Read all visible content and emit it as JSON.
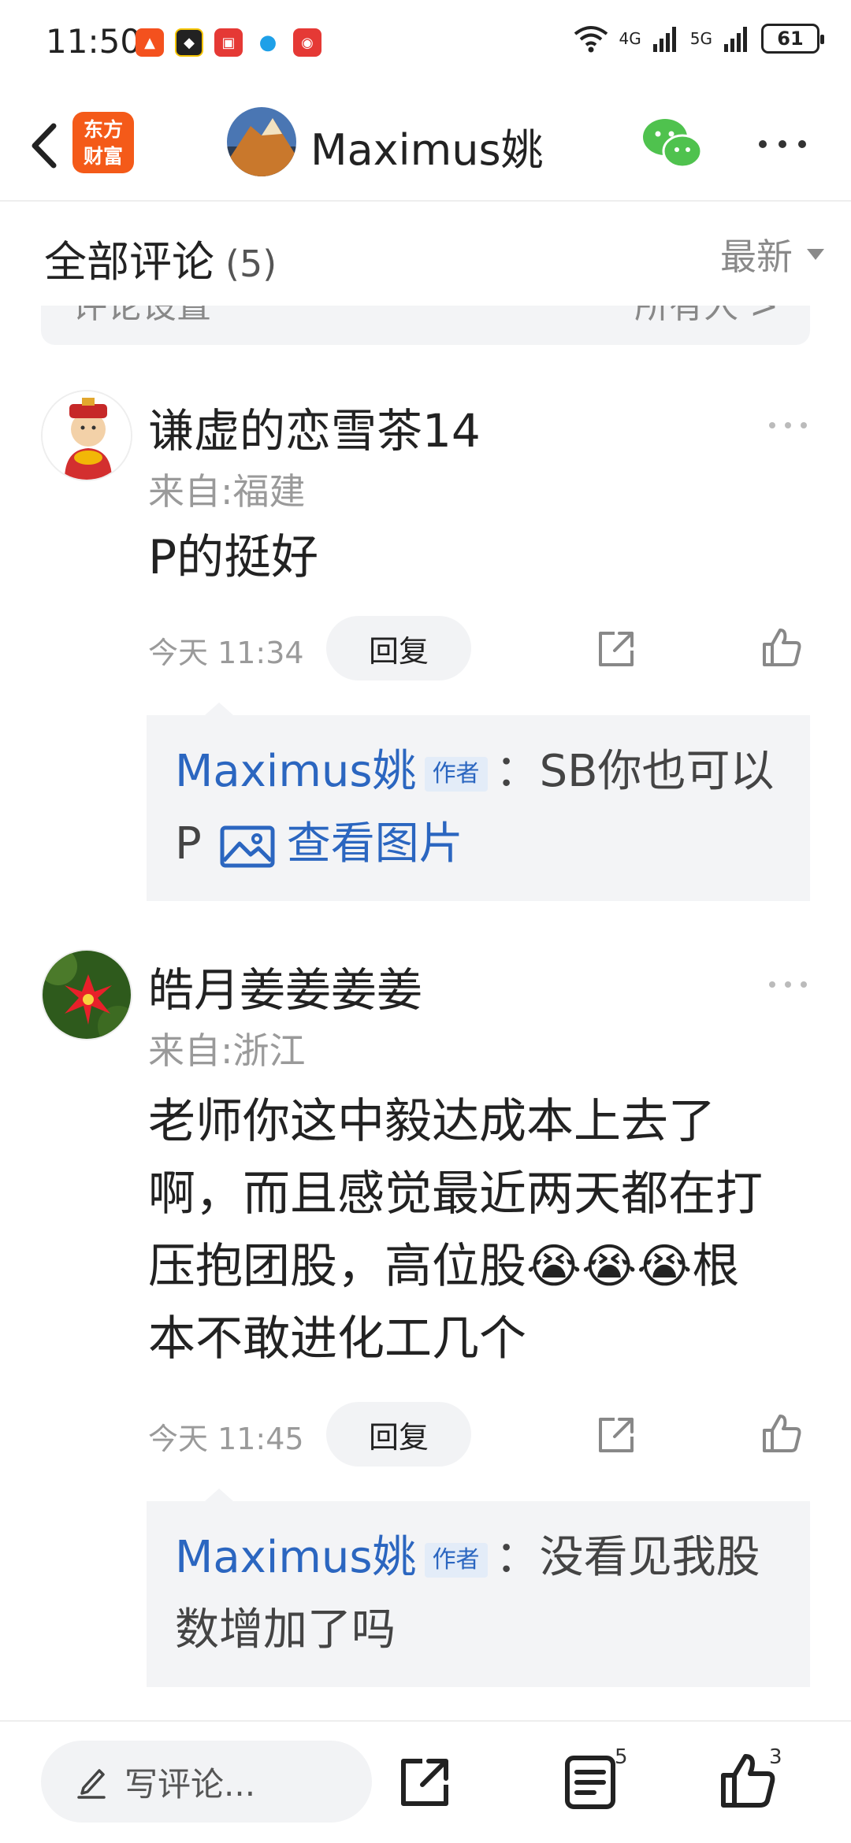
{
  "status_bar": {
    "time": "11:50",
    "network_1": "4G",
    "network_2": "5G",
    "battery": "61"
  },
  "header": {
    "brand_line1": "东方",
    "brand_line2": "财富",
    "title": "Maximus姚"
  },
  "section": {
    "title": "全部评论",
    "count": "(5)",
    "sort_label": "最新",
    "settings_ghost": "评论设置",
    "settings_ghost_right": "所有人 >"
  },
  "comments": [
    {
      "name": "谦虚的恋雪茶14",
      "location": "来自:福建",
      "text": "P的挺好",
      "time": "今天 11:34",
      "reply_label": "回复",
      "reply": {
        "author": "Maximus姚",
        "tag": "作者",
        "text": "：SB你也可以P",
        "view_image": "查看图片"
      }
    },
    {
      "name": "皓月姜姜姜姜",
      "location": "来自:浙江",
      "text": "老师你这中毅达成本上去了啊，而且感觉最近两天都在打压抱团股，高位股😭😭😭根本不敢进化工几个",
      "time": "今天 11:45",
      "reply_label": "回复",
      "reply": {
        "author": "Maximus姚",
        "tag": "作者",
        "text": "：没看见我股数增加了吗"
      }
    }
  ],
  "bottom_bar": {
    "write_placeholder": "写评论...",
    "comments_badge": "5",
    "likes_badge": "3"
  },
  "colors": {
    "brand_orange": "#f45a19",
    "link_blue": "#2b66c0",
    "wechat_green": "#4fc24e"
  }
}
